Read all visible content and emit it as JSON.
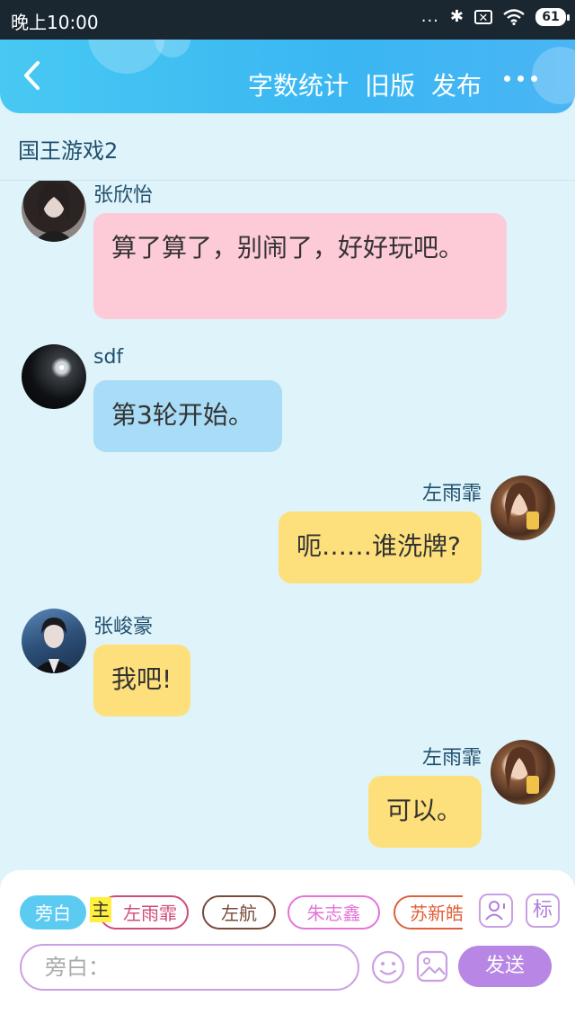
{
  "status_bar": {
    "time": "晚上10:00",
    "dots": "...",
    "bluetooth": "✱",
    "sim": "✕",
    "battery": "61"
  },
  "header": {
    "back_icon": "chevron-left-icon",
    "actions": [
      "字数统计",
      "旧版",
      "发布"
    ],
    "more_icon": "more-dots-icon",
    "gradient_colors": [
      "#47c9f3",
      "#3ab6f2"
    ]
  },
  "chat": {
    "title": "国王游戏2",
    "messages": [
      {
        "sender": "张欣怡",
        "text": "算了算了，别闹了，好好玩吧。",
        "side": "left",
        "color": "#fdcad7"
      },
      {
        "sender": "sdf",
        "text": "第3轮开始。",
        "side": "left",
        "color": "#a9dcf6"
      },
      {
        "sender": "左雨霏",
        "text": "呃……谁洗牌?",
        "side": "right",
        "color": "#fde07b"
      },
      {
        "sender": "张峻豪",
        "text": "我吧!",
        "side": "left",
        "color": "#fde07b"
      },
      {
        "sender": "左雨霏",
        "text": "可以。",
        "side": "right",
        "color": "#fde07b"
      }
    ]
  },
  "composer": {
    "narration_chip": "旁白",
    "main_marker": "主",
    "role_chips": [
      "左雨霏",
      "左航",
      "朱志鑫",
      "苏新皓"
    ],
    "tag_button": "标",
    "input_placeholder": "旁白：",
    "send_label": "发送"
  }
}
